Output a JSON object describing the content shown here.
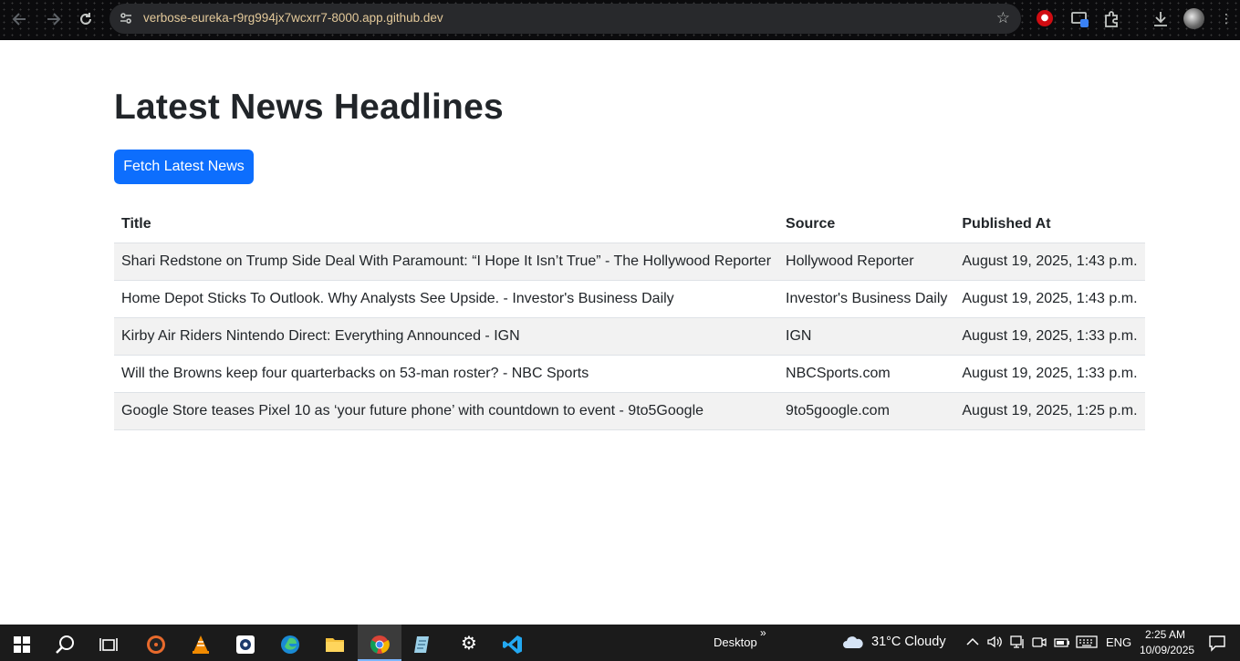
{
  "browser": {
    "url": "verbose-eureka-r9rg994jx7wcxrr7-8000.app.github.dev",
    "icons": [
      "back-icon",
      "forward-icon",
      "reload-icon",
      "site-info-icon",
      "bookmark-star-icon",
      "extension-red-icon",
      "cast-icon",
      "extensions-puzzle-icon",
      "download-icon",
      "profile-avatar",
      "menu-dots-icon"
    ]
  },
  "page": {
    "heading": "Latest News Headlines",
    "fetch_button": "Fetch Latest News",
    "table": {
      "headers": [
        "Title",
        "Source",
        "Published At"
      ],
      "rows": [
        {
          "title": "Shari Redstone on Trump Side Deal With Paramount: “I Hope It Isn’t True” - The Hollywood Reporter",
          "source": "Hollywood Reporter",
          "published": "August 19, 2025, 1:43 p.m."
        },
        {
          "title": "Home Depot Sticks To Outlook. Why Analysts See Upside. - Investor's Business Daily",
          "source": "Investor's Business Daily",
          "published": "August 19, 2025, 1:43 p.m."
        },
        {
          "title": "Kirby Air Riders Nintendo Direct: Everything Announced - IGN",
          "source": "IGN",
          "published": "August 19, 2025, 1:33 p.m."
        },
        {
          "title": "Will the Browns keep four quarterbacks on 53-man roster? - NBC Sports",
          "source": "NBCSports.com",
          "published": "August 19, 2025, 1:33 p.m."
        },
        {
          "title": "Google Store teases Pixel 10 as ‘your future phone’ with countdown to event - 9to5Google",
          "source": "9to5google.com",
          "published": "August 19, 2025, 1:25 p.m."
        }
      ]
    }
  },
  "taskbar": {
    "desktop_label": "Desktop",
    "chevron": "»",
    "weather": "31°C  Cloudy",
    "language": "ENG",
    "time": "2:25 AM",
    "date": "10/09/2025"
  },
  "colors": {
    "primary_button": "#0d6efd",
    "stripe": "#f2f2f2",
    "url_text": "#e3c99a"
  }
}
